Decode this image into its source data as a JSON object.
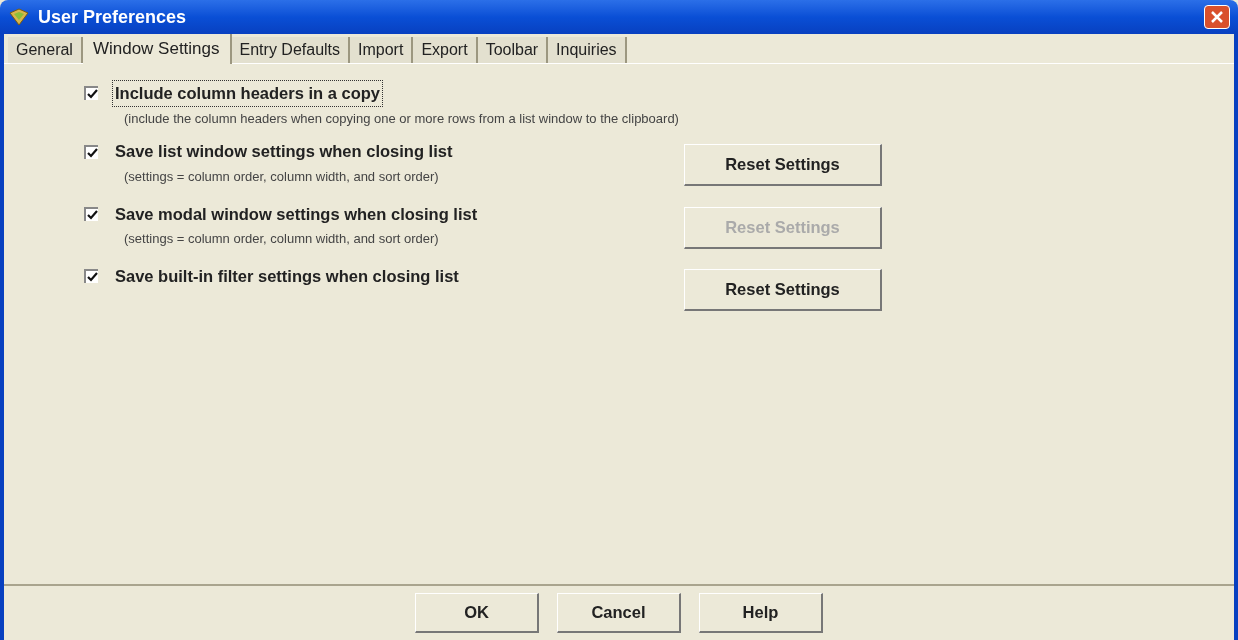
{
  "window": {
    "title": "User Preferences"
  },
  "tabs": [
    {
      "label": "General",
      "selected": false
    },
    {
      "label": "Window Settings",
      "selected": true
    },
    {
      "label": "Entry Defaults",
      "selected": false
    },
    {
      "label": "Import",
      "selected": false
    },
    {
      "label": "Export",
      "selected": false
    },
    {
      "label": "Toolbar",
      "selected": false
    },
    {
      "label": "Inquiries",
      "selected": false
    }
  ],
  "options": [
    {
      "label": "Include column headers in a copy",
      "checked": true,
      "focused": true,
      "hint": "(include the column headers when copying one or more rows from a list window to the clipboard)"
    },
    {
      "label": "Save list window settings when closing list",
      "checked": true,
      "focused": false,
      "hint": "(settings = column order, column width, and sort order)",
      "button": {
        "label": "Reset Settings",
        "disabled": false
      }
    },
    {
      "label": "Save modal window settings when closing list",
      "checked": true,
      "focused": false,
      "hint": "(settings = column order, column width, and sort order)",
      "button": {
        "label": "Reset Settings",
        "disabled": true
      }
    },
    {
      "label": "Save built-in filter settings when closing list",
      "checked": true,
      "focused": false,
      "button": {
        "label": "Reset Settings",
        "disabled": false
      }
    }
  ],
  "buttons": [
    {
      "label": "OK"
    },
    {
      "label": "Cancel"
    },
    {
      "label": "Help"
    }
  ]
}
